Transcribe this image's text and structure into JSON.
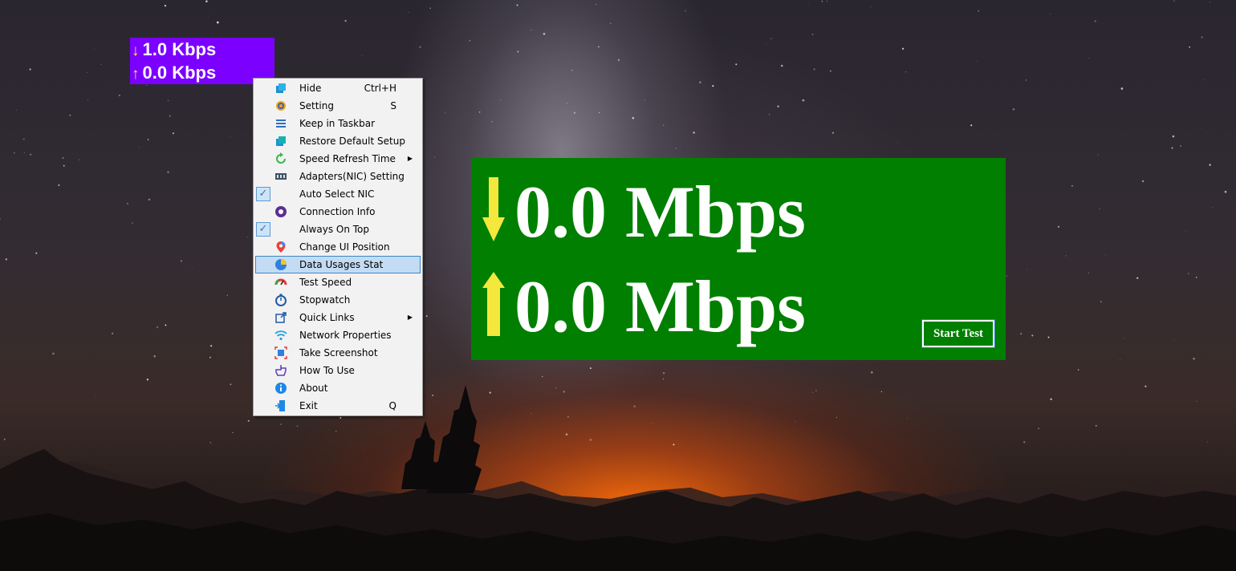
{
  "mini_widget": {
    "download_arrow": "↓",
    "download_text": "1.0 Kbps",
    "upload_arrow": "↑",
    "upload_text": "0.0 Kbps"
  },
  "big_widget": {
    "download_text": "0.0 Mbps",
    "upload_text": "0.0 Mbps",
    "start_test_label": "Start Test"
  },
  "context_menu": {
    "items": [
      {
        "label": "Hide",
        "shortcut": "Ctrl+H",
        "icon": "hide-icon"
      },
      {
        "label": "Setting",
        "shortcut": "S",
        "icon": "gear-icon"
      },
      {
        "label": "Keep in Taskbar",
        "icon": "taskbar-icon"
      },
      {
        "label": "Restore Default Setup",
        "icon": "restore-icon"
      },
      {
        "label": "Speed Refresh Time",
        "icon": "refresh-icon",
        "submenu": true
      },
      {
        "label": "Adapters(NIC) Setting",
        "icon": "network-adapter-icon"
      },
      {
        "label": "Auto Select NIC",
        "checked": true
      },
      {
        "label": "Connection Info",
        "icon": "connection-info-icon"
      },
      {
        "label": "Always On Top",
        "checked": true
      },
      {
        "label": "Change UI Position",
        "icon": "map-pin-icon"
      },
      {
        "label": "Data Usages Stat",
        "icon": "pie-chart-icon",
        "highlighted": true
      },
      {
        "label": "Test Speed",
        "icon": "speedometer-icon"
      },
      {
        "label": "Stopwatch",
        "icon": "stopwatch-icon"
      },
      {
        "label": "Quick Links",
        "icon": "external-link-icon",
        "submenu": true
      },
      {
        "label": "Network Properties",
        "icon": "wifi-icon"
      },
      {
        "label": "Take Screenshot",
        "icon": "screenshot-icon"
      },
      {
        "label": "How To Use",
        "icon": "hand-pointer-icon"
      },
      {
        "label": "About",
        "icon": "info-icon"
      },
      {
        "label": "Exit",
        "shortcut": "Q",
        "icon": "exit-icon"
      }
    ],
    "submenu_arrow": "▶",
    "check_mark": "✓"
  },
  "colors": {
    "mini_widget_bg": "#7c00ff",
    "big_widget_bg": "#007f00",
    "arrow_yellow": "#ffe94a",
    "menu_highlight": "#c3dcf3"
  }
}
